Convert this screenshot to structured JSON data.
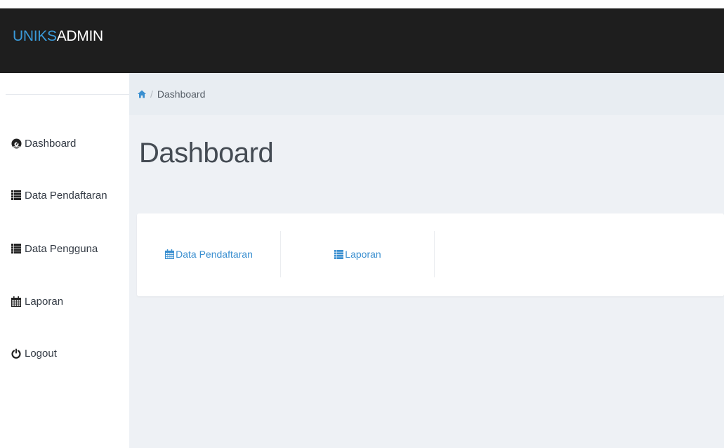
{
  "brand": {
    "part1": "UNIKS",
    "part2": "ADMIN",
    "color_part1": "#3a9ad9"
  },
  "breadcrumb": {
    "home_icon": "home-icon",
    "separator": "/",
    "current": "Dashboard"
  },
  "page": {
    "title": "Dashboard"
  },
  "sidebar": {
    "items": [
      {
        "label": "Dashboard",
        "icon": "dashboard-icon"
      },
      {
        "label": "Data Pendaftaran",
        "icon": "list-icon"
      },
      {
        "label": "Data Pengguna",
        "icon": "list-icon"
      },
      {
        "label": "Laporan",
        "icon": "calendar-icon"
      },
      {
        "label": "Logout",
        "icon": "power-icon"
      }
    ]
  },
  "card": {
    "links": [
      {
        "label": "Data Pendaftaran",
        "icon": "calendar-icon"
      },
      {
        "label": "Laporan",
        "icon": "list-icon"
      }
    ]
  },
  "colors": {
    "topbar": "#1e1e1e",
    "accent": "#3a8fd0",
    "background": "#eef1f5"
  }
}
